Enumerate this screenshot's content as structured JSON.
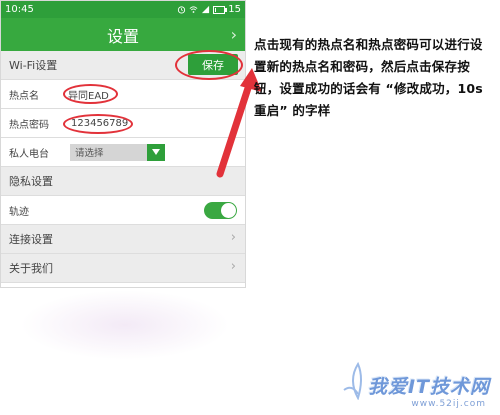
{
  "status_bar": {
    "time": "10:45",
    "battery": "15",
    "battery_level": 0.15,
    "icons": [
      "alarm-icon",
      "wifi-icon",
      "signal-icon",
      "battery-icon"
    ]
  },
  "header": {
    "title": "设置"
  },
  "sections": {
    "wifi": {
      "label": "Wi-Fi设置",
      "save_label": "保存",
      "hotspot_name_label": "热点名",
      "hotspot_name_value": "异同EAD",
      "hotspot_password_label": "热点密码",
      "hotspot_password_value": "123456789",
      "radio_label": "私人电台",
      "radio_placeholder": "请选择"
    },
    "privacy": {
      "label": "隐私设置",
      "track_label": "轨迹",
      "track_enabled": true
    },
    "connection_label": "连接设置",
    "about_label": "关于我们"
  },
  "instructions": {
    "text": "点击现有的热点名和热点密码可以进行设置新的热点名和密码，然后点击保存按钮，设置成功的话会有 “修改成功，10s 重启” 的字样"
  },
  "watermark": {
    "name": "我爱IT技术网",
    "url": "www.52ij.com"
  },
  "colors": {
    "brand_green": "#37a93f",
    "highlight_red": "#e2323a",
    "watermark_blue": "#6f98d9"
  }
}
